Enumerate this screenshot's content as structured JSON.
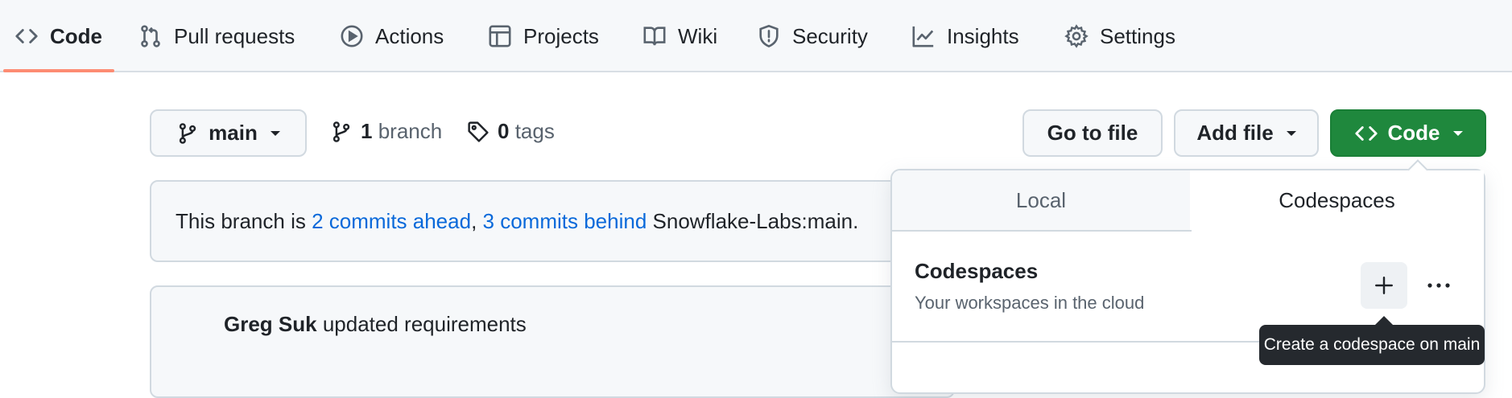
{
  "repo_nav": {
    "items": [
      {
        "label": "Code",
        "icon": "code-icon"
      },
      {
        "label": "Pull requests",
        "icon": "git-pull-request-icon"
      },
      {
        "label": "Actions",
        "icon": "play-icon"
      },
      {
        "label": "Projects",
        "icon": "table-icon"
      },
      {
        "label": "Wiki",
        "icon": "book-icon"
      },
      {
        "label": "Security",
        "icon": "shield-icon"
      },
      {
        "label": "Insights",
        "icon": "graph-icon"
      },
      {
        "label": "Settings",
        "icon": "gear-icon"
      }
    ],
    "selected": "Code"
  },
  "branch_bar": {
    "branch_name": "main",
    "branch_count": "1",
    "branch_word": "branch",
    "tag_count": "0",
    "tag_word": "tags",
    "go_to_file": "Go to file",
    "add_file": "Add file",
    "code_button": "Code"
  },
  "branch_status": {
    "prefix": "This branch is",
    "ahead": "2 commits ahead",
    "separator": ",",
    "behind": "3 commits behind",
    "suffix": "Snowflake-Labs:main."
  },
  "latest_commit": {
    "author": "Greg Suk",
    "message": "updated requirements"
  },
  "code_dropdown": {
    "tabs": [
      "Local",
      "Codespaces"
    ],
    "active_tab": "Codespaces",
    "title": "Codespaces",
    "subtitle": "Your workspaces in the cloud",
    "tooltip": "Create a codespace on main"
  },
  "colors": {
    "accent_green": "#1f883d",
    "link_blue": "#0969da",
    "nav_underline": "#fd8c73"
  }
}
